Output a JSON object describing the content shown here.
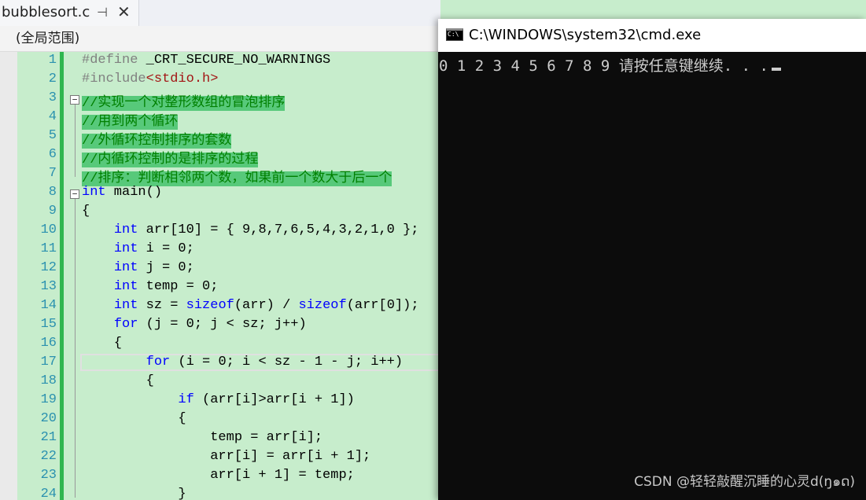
{
  "editor": {
    "tab_title": "bubblesort.c",
    "pin_glyph": "⊣",
    "close_glyph": "✕",
    "scope": "(全局范围)",
    "line_numbers": [
      "1",
      "2",
      "3",
      "4",
      "5",
      "6",
      "7",
      "8",
      "9",
      "10",
      "11",
      "12",
      "13",
      "14",
      "15",
      "16",
      "17",
      "18",
      "19",
      "20",
      "21",
      "22",
      "23",
      "24"
    ],
    "lines": [
      "#define _CRT_SECURE_NO_WARNINGS",
      "#include<stdio.h>",
      "//实现一个对整形数组的冒泡排序",
      "//用到两个循环",
      "//外循环控制排序的套数",
      "//内循环控制的是排序的过程",
      "//排序：判断相邻两个数，如果前一个数大于后一个",
      "int main()",
      "{",
      "    int arr[10] = { 9,8,7,6,5,4,3,2,1,0 };",
      "    int i = 0;",
      "    int j = 0;",
      "    int temp = 0;",
      "    int sz = sizeof(arr) / sizeof(arr[0]);",
      "    for (j = 0; j < sz; j++)",
      "    {",
      "        for (i = 0; i < sz - 1 - j; i++)",
      "        {",
      "            if (arr[i]>arr[i + 1])",
      "            {",
      "                temp = arr[i];",
      "                arr[i] = arr[i + 1];",
      "                arr[i + 1] = temp;",
      "            }"
    ]
  },
  "cmd": {
    "title": "C:\\WINDOWS\\system32\\cmd.exe",
    "icon_text": "C:\\",
    "output": "0 1 2 3 4 5 6 7 8 9 请按任意键继续. . ."
  },
  "watermark": "CSDN @轻轻敲醒沉睡的心灵d(ŋ๑ດ)"
}
